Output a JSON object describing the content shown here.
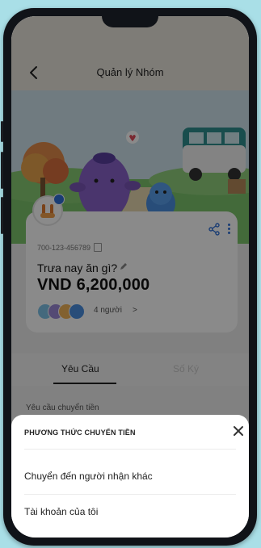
{
  "header": {
    "title": "Quản lý Nhóm"
  },
  "group": {
    "account_number": "700-123-456789",
    "name": "Trưa nay ăn gì?",
    "balance": "VND 6,200,000",
    "member_count": "4 người",
    "member_chevron": ">"
  },
  "tabs": [
    {
      "label": "Yêu Cầu",
      "active": true
    },
    {
      "label": "Số Ký",
      "active": false
    }
  ],
  "below": {
    "row_label": "Yêu cầu chuyển tiền"
  },
  "transfer_sheet": {
    "title": "PHƯƠNG THỨC CHUYỂN TIỀN",
    "close_label": "✕",
    "options": [
      {
        "label": "Chuyển đến người nhận khác"
      },
      {
        "label": "Tài khoản của tôi"
      }
    ]
  },
  "colors": {
    "background": "#a9dfe7",
    "accent_blue": "#2f6fd6",
    "overlay": "rgba(0,0,0,0.46)"
  }
}
